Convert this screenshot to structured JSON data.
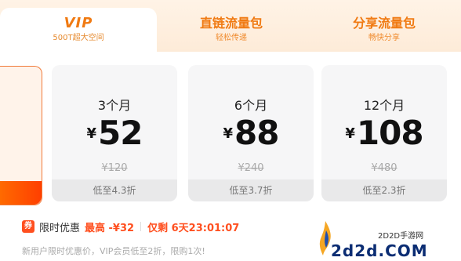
{
  "tabs": [
    {
      "title": "VIP",
      "subtitle": "500T超大空间"
    },
    {
      "title": "直链流量包",
      "subtitle": "轻松传递"
    },
    {
      "title": "分享流量包",
      "subtitle": "畅快分享"
    }
  ],
  "plans": [
    {
      "duration": "3个月",
      "currency": "¥",
      "price": "52",
      "original": "¥120",
      "discount": "低至4.3折"
    },
    {
      "duration": "6个月",
      "currency": "¥",
      "price": "88",
      "original": "¥240",
      "discount": "低至3.7折"
    },
    {
      "duration": "12个月",
      "currency": "¥",
      "price": "108",
      "original": "¥480",
      "discount": "低至2.3折"
    }
  ],
  "promo": {
    "tag": "券",
    "label": "限时优惠",
    "max_off": "最高 -¥32",
    "remaining": "仅剩 6天23:01:07"
  },
  "note": "新用户限时优惠价，VIP会员低至2折，限购1次!",
  "watermark": {
    "site": "2D2D手游网",
    "domain": "2d2d.COM"
  },
  "colors": {
    "accent": "#f07a12",
    "sale": "#ff4f1f",
    "brand_blue": "#0b2d73"
  }
}
